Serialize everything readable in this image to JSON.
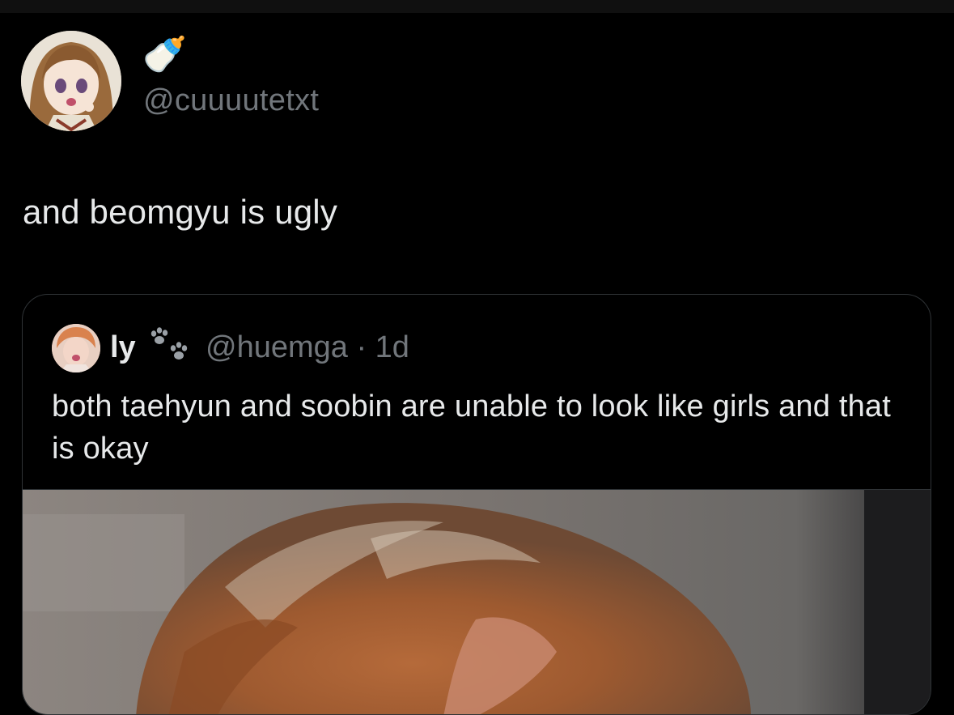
{
  "author": {
    "display_name": "🍼",
    "handle": "@cuuuutetxt",
    "avatar": "anime-doll-avatar"
  },
  "tweet": {
    "text": "and beomgyu is ugly"
  },
  "quoted_tweet": {
    "display_name": "ly",
    "name_emoji": "paw-prints-icon",
    "handle_time": "@huemga · 1d",
    "text": "both taehyun and soobin are unable to look like girls and that is okay",
    "media": "photo-of-person-with-brown-hair"
  },
  "colors": {
    "background": "#000000",
    "text_primary": "#e7e9ea",
    "text_secondary": "#71767b",
    "border": "#2f3336"
  }
}
